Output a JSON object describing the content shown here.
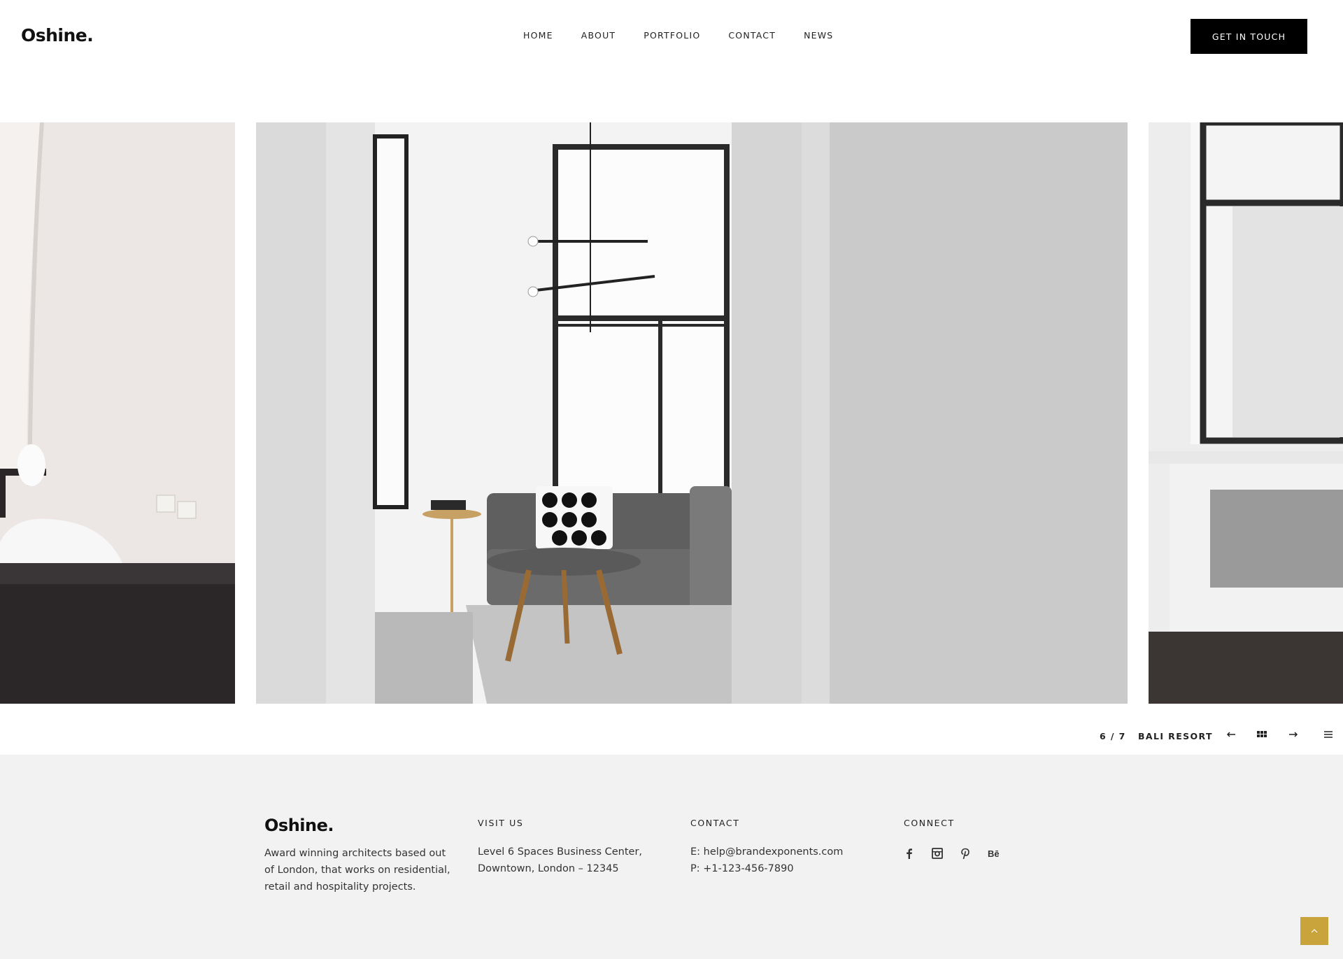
{
  "header": {
    "logo": "Oshine.",
    "nav": [
      "HOME",
      "ABOUT",
      "PORTFOLIO",
      "CONTACT",
      "NEWS"
    ],
    "cta_label": "GET IN TOUCH"
  },
  "slider": {
    "counter": "6 / 7",
    "title": "BALI RESORT",
    "icons": [
      "arrow-left-icon",
      "grid-icon",
      "arrow-right-icon",
      "menu-icon"
    ]
  },
  "footer": {
    "logo": "Oshine.",
    "about_line1": "Award winning architects based out",
    "about_line2": "of London, that works on residential,",
    "about_line3": "retail and hospitality projects.",
    "visit_heading": "VISIT US",
    "visit_line1": "Level 6 Spaces Business Center,",
    "visit_line2": "Downtown, London – 12345",
    "contact_heading": "CONTACT",
    "contact_email": "E: help@brandexponents.com",
    "contact_phone": "P: +1-123-456-7890",
    "connect_heading": "CONNECT",
    "social_icons": [
      "facebook-icon",
      "instagram-icon",
      "pinterest-icon",
      "behance-icon"
    ],
    "behance_text": "Bē"
  },
  "colors": {
    "accent": "#c9a33b",
    "cta_bg": "#000000",
    "footer_bg": "#f2f2f2"
  }
}
